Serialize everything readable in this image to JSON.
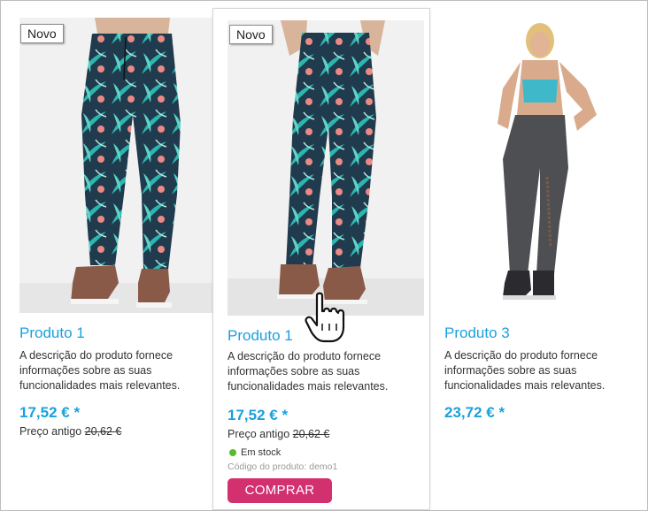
{
  "products": [
    {
      "badge": "Novo",
      "name": "Produto 1",
      "description": "A descrição do produto fornece informações sobre as suas funcionalidades mais relevantes.",
      "price": "17,52 € *",
      "old_price_label": "Preço antigo",
      "old_price": "20,62 €"
    },
    {
      "badge": "Novo",
      "name": "Produto 1",
      "description": "A descrição do produto fornece informações sobre as suas funcionalidades mais relevantes.",
      "price": "17,52 € *",
      "old_price_label": "Preço antigo",
      "old_price": "20,62 €",
      "stock": "Em stock",
      "code": "Código do produto: demo1",
      "buy_label": "COMPRAR"
    },
    {
      "name": "Produto 3",
      "description": "A descrição do produto fornece informações sobre as suas funcionalidades mais relevantes.",
      "price": "23,72 € *"
    }
  ],
  "colors": {
    "accent": "#1aa0de",
    "buy_button": "#d2306f",
    "in_stock": "#5cb82d"
  },
  "icons": {
    "cursor": "hand-pointer-icon"
  }
}
